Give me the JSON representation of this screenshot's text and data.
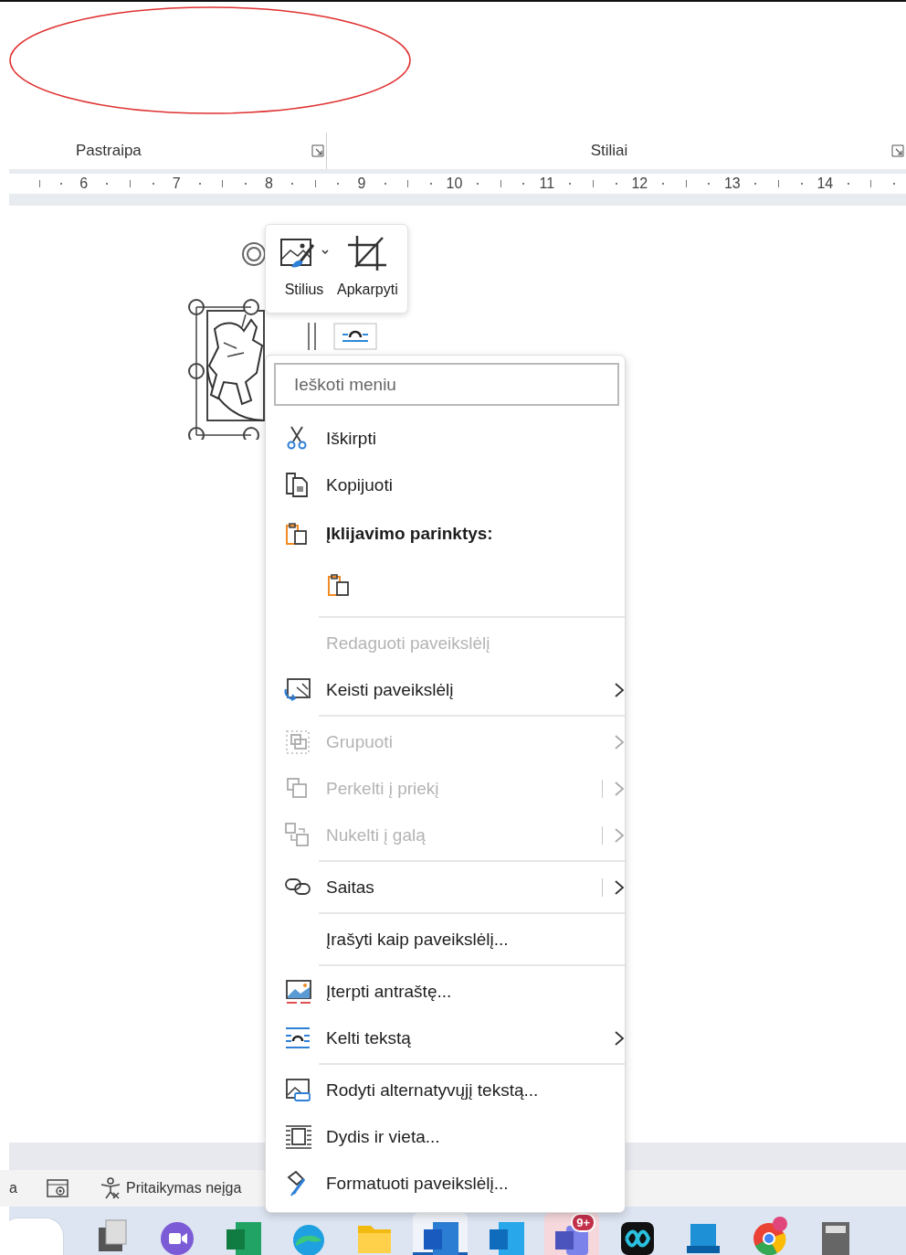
{
  "ribbon": {
    "groups": [
      {
        "label": "Pastraipa"
      },
      {
        "label": "Stiliai"
      }
    ]
  },
  "ruler": {
    "numbers": [
      "6",
      "7",
      "8",
      "9",
      "10",
      "11",
      "12",
      "13",
      "14"
    ]
  },
  "mini_toolbar": {
    "buttons": [
      {
        "label": "Stilius",
        "kind": "style"
      },
      {
        "label": "Apkarpyti",
        "kind": "crop"
      }
    ]
  },
  "context_menu": {
    "search": {
      "placeholder": "Ieškoti meniu"
    },
    "items": [
      {
        "kind": "command",
        "label": "Iškirpti",
        "disabled": false,
        "submenu": false,
        "split": false
      },
      {
        "kind": "command",
        "label": "Kopijuoti",
        "disabled": false,
        "submenu": false,
        "split": false
      },
      {
        "kind": "heading",
        "label": "Įklijavimo parinktys:"
      },
      {
        "kind": "paste_options"
      },
      {
        "kind": "separator"
      },
      {
        "kind": "command",
        "label": "Redaguoti paveikslėlį",
        "disabled": true,
        "submenu": false,
        "split": false
      },
      {
        "kind": "command",
        "label": "Keisti paveikslėlį",
        "disabled": false,
        "submenu": true,
        "split": false
      },
      {
        "kind": "separator"
      },
      {
        "kind": "command",
        "label": "Grupuoti",
        "disabled": true,
        "submenu": true,
        "split": false
      },
      {
        "kind": "command",
        "label": "Perkelti į priekį",
        "disabled": true,
        "submenu": true,
        "split": true
      },
      {
        "kind": "command",
        "label": "Nukelti į galą",
        "disabled": true,
        "submenu": true,
        "split": true
      },
      {
        "kind": "separator"
      },
      {
        "kind": "command",
        "label": "Saitas",
        "disabled": false,
        "submenu": true,
        "split": true
      },
      {
        "kind": "separator"
      },
      {
        "kind": "command",
        "label": "Įrašyti kaip paveikslėlį...",
        "disabled": false,
        "submenu": false,
        "split": false
      },
      {
        "kind": "separator"
      },
      {
        "kind": "command",
        "label": "Įterpti antraštę...",
        "disabled": false,
        "submenu": false,
        "split": false
      },
      {
        "kind": "command",
        "label": "Kelti tekstą",
        "disabled": false,
        "submenu": true,
        "split": false
      },
      {
        "kind": "separator"
      },
      {
        "kind": "command",
        "label": "Rodyti alternatyvųjį tekstą...",
        "disabled": false,
        "submenu": false,
        "split": false
      },
      {
        "kind": "command",
        "label": "Dydis ir vieta...",
        "disabled": false,
        "submenu": false,
        "split": false
      },
      {
        "kind": "command",
        "label": "Formatuoti paveikslėlį...",
        "disabled": false,
        "submenu": false,
        "split": false
      }
    ]
  },
  "status_bar": {
    "texts": [
      "a",
      "Pritaikymas neįga"
    ]
  },
  "taskbar": {
    "apps": [
      {
        "selected": false,
        "flashing": false
      },
      {
        "selected": false,
        "flashing": false
      },
      {
        "selected": false,
        "flashing": false
      },
      {
        "selected": false,
        "flashing": false
      },
      {
        "selected": false,
        "flashing": false
      },
      {
        "selected": true,
        "flashing": false
      },
      {
        "selected": false,
        "flashing": false
      },
      {
        "selected": false,
        "flashing": true,
        "badge": "9+"
      },
      {
        "selected": false,
        "flashing": false
      },
      {
        "selected": false,
        "flashing": false
      },
      {
        "selected": false,
        "flashing": false
      },
      {
        "selected": false,
        "flashing": false
      }
    ]
  }
}
